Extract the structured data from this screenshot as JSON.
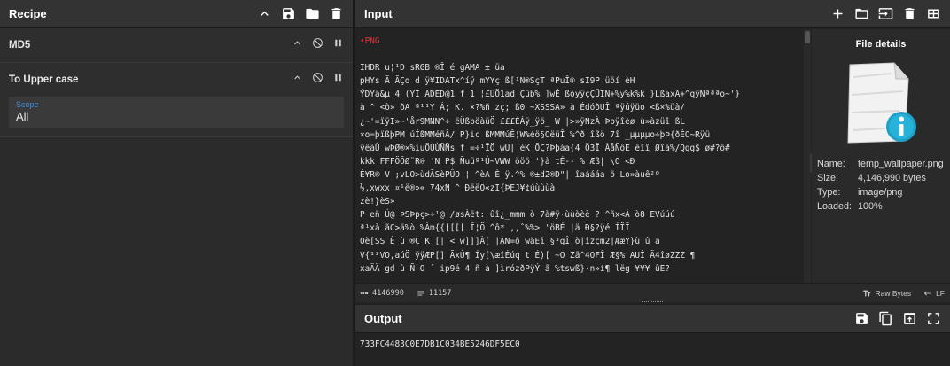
{
  "recipe": {
    "title": "Recipe",
    "operations": [
      {
        "name": "MD5"
      },
      {
        "name": "To Upper case",
        "arg_label": "Scope",
        "arg_value": "All"
      }
    ]
  },
  "input": {
    "title": "Input",
    "lines": [
      "•PNG",
      "",
      "IHDR                    u¦¹D       sRGB ®Î  é       gAMA  ±  üa",
      "     pHYs         Ã      ÃÇo d     ÿ¥IDATx^íý   mYYç ß[¹N®SçT ªPuÎ®  sI9P üöí  èH",
      "ÝDYä&µ 4 (YI   ADED@1  f   1 ¦£UÖ1ad  Çûb%  ]wÉ  ßóyÿçÇÜIN+%y%k%k }LßaxA+^qÿNªªªo~'}",
      "à   ^ <ò» ðA   ª¹¹Y    Á;  K.   ×?%ñ zç; ß0   ~XSSSA»    à ÉdóðUÎ ªÿúÿüo <ß×%üà/",
      "¿~'=ïÿI»~'år9MNN^÷     ëÜßþöàüÖ  £££ÉÁÿ_ÿö_  W |>»ÿNzÀ  Þþÿîèø  ù»àzüî  ßL",
      "×o=þïßþPM   úÍßMMéñÂ/ P}ic   ßMMMúÊ¦W%éö§OëüÎ %^ð  îßö 7î  _µµµµo÷þÞ{ðÉO~Rÿü",
      "ÿëàÛ wÞØ®×%ìuÖÙÙÑÑs  f  =÷¹ÏÖ wU|  éK   ÕÇ?Þþàa{4  Ö3Ï   ÀåÑôE  ëîî  Øîà%/Qgg$  ø#?ö#",
      "  kkk    FFFÖÖØ¨R®   'N P$   Ñuüº¹Ú~VWW    ööö  '}à   tÉ--  %   Æß|  \\O <Ð   ",
      "É¥R® V          ;vLO>ùdÄSèPÛO    ¦ ^èA   È   ÿ.^%    ®±d2®D\"|    îaáááa   ö Lo»àuê²º",
      "½,xwxx  ¤¹ë®»« 74xÑ ^   ÐëëÖ«zI{ÞEJ¥¢úùùùà",
      "   zè!}èS»",
      "P      eñ   Ú@   ÞSÞpç>÷¹@   /øsÀët:  ûî¿_mmm     ò  7à#ÿ·ùùòèè ? ^ñx<À ò8    EVúúú",
      "ª¹xà ãC>ä%ò %Àm{{[[[[   Ï¦Ö ^ô* ,,ˆ%%> 'öBÉ |ä    Ð§?ÿé   ÍÏÏ     ",
      "Oè[SS   È    ù    ®C K [| < w]]]À[   |ÀN=ð wäEî §³gÎ  ò|îzçm2|ÆæY}ù  û a   ",
      "V{¹²VO,aúÖ  ÿÿÆP[]  ÃxÙ¶  Íy[\\æîÉúq  t  É)[      ~O  Zã^4OFÎ   Æ§%  AUÎ    Ä4îøZZZ   ¶   ",
      "xaÄÄ gd  ù  Ñ O    ´  ip9é  4 ñ    à    ]ìrózðPÿÝ   ã    %tswß}·n»í¶ lëg ¥¥¥   ûE?"
    ],
    "details": {
      "title": "File details",
      "rows": [
        {
          "key": "Name:",
          "value": "temp_wallpaper.png"
        },
        {
          "key": "Size:",
          "value": "4,146,990 bytes"
        },
        {
          "key": "Type:",
          "value": "image/png"
        },
        {
          "key": "Loaded:",
          "value": "100%"
        }
      ]
    },
    "status": {
      "length": "4146990",
      "lines": "11157",
      "encoding": "Raw Bytes",
      "eol": "LF"
    }
  },
  "output": {
    "title": "Output",
    "text": "733FC4483C0E7DB1C034BE5246DF5EC0"
  }
}
